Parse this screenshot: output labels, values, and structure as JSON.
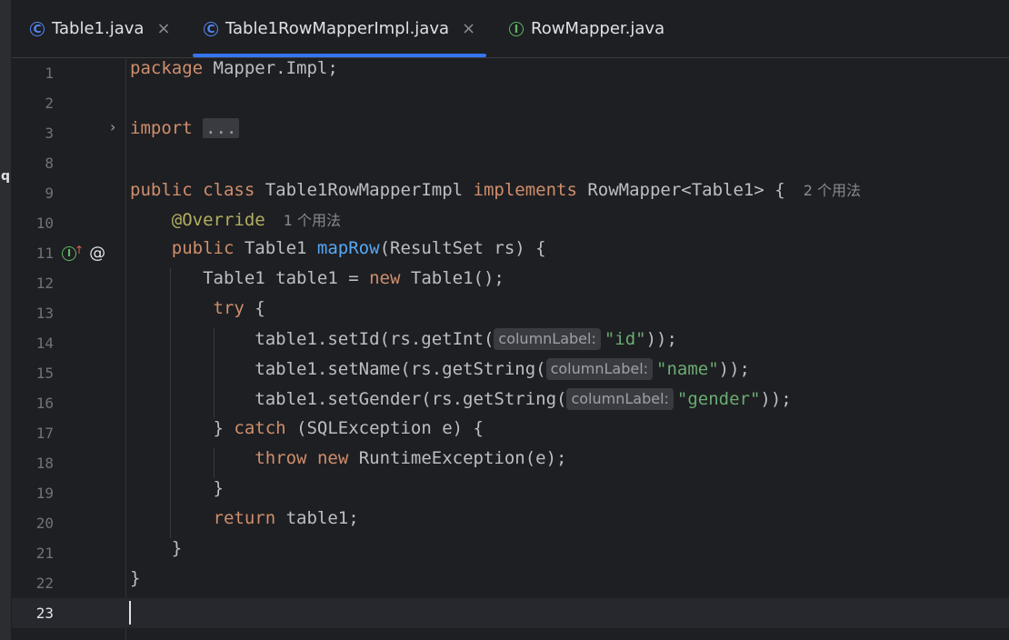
{
  "tabs": [
    {
      "label": "Table1.java",
      "icon": "C",
      "active": false,
      "closable": true
    },
    {
      "label": "Table1RowMapperImpl.java",
      "icon": "C",
      "active": true,
      "closable": true
    },
    {
      "label": "RowMapper.java",
      "icon": "I",
      "active": false,
      "closable": false
    }
  ],
  "close_glyph": "×",
  "left_strip_glyph": "q",
  "gutter": {
    "impl_icon": "I",
    "up_arrow": "↑",
    "at": "@"
  },
  "line_numbers": [
    "1",
    "2",
    "3",
    "8",
    "9",
    "10",
    "11",
    "12",
    "13",
    "14",
    "15",
    "16",
    "17",
    "18",
    "19",
    "20",
    "21",
    "22",
    "23"
  ],
  "current_line": "23",
  "code": {
    "l1": {
      "kw": "package",
      "rest": " Mapper.Impl;"
    },
    "l3": {
      "kw": "import",
      "fold": "..."
    },
    "l9": {
      "kw1": "public",
      "kw2": "class",
      "name": " Table1RowMapperImpl ",
      "kw3": "implements",
      "rest": " RowMapper<Table1> {",
      "usage": "2 个用法"
    },
    "l10": {
      "ann": "@Override",
      "usage": "1 个用法"
    },
    "l11": {
      "kw": "public",
      "t1": " Table1 ",
      "fn": "mapRow",
      "rest": "(ResultSet rs) {"
    },
    "l12": {
      "a": "Table1 table1 = ",
      "kw": "new",
      "b": " Table1();"
    },
    "l13": {
      "kw": "try",
      "rest": " {"
    },
    "l14": {
      "a": "table1.setId(rs.getInt(",
      "hint": "columnLabel:",
      "str": "\"id\"",
      "b": "));"
    },
    "l15": {
      "a": "table1.setName(rs.getString(",
      "hint": "columnLabel:",
      "str": "\"name\"",
      "b": "));"
    },
    "l16": {
      "a": "table1.setGender(rs.getString(",
      "hint": "columnLabel:",
      "str": "\"gender\"",
      "b": "));"
    },
    "l17": {
      "a": "} ",
      "kw": "catch",
      "b": " (SQLException e) {"
    },
    "l18": {
      "kw1": "throw",
      "kw2": "new",
      "b": " RuntimeException(e);"
    },
    "l19": {
      "a": "}"
    },
    "l20": {
      "kw": "return",
      "b": " table1;"
    },
    "l21": {
      "a": "}"
    },
    "l22": {
      "a": "}"
    }
  },
  "colors": {
    "background": "#1e1f22",
    "keyword": "#cf8e6d",
    "string": "#6aab73",
    "function": "#56a8f5",
    "annotation": "#b3ae60",
    "accent": "#3574f0",
    "class_icon": "#548af7",
    "interface_icon": "#5fb865"
  }
}
